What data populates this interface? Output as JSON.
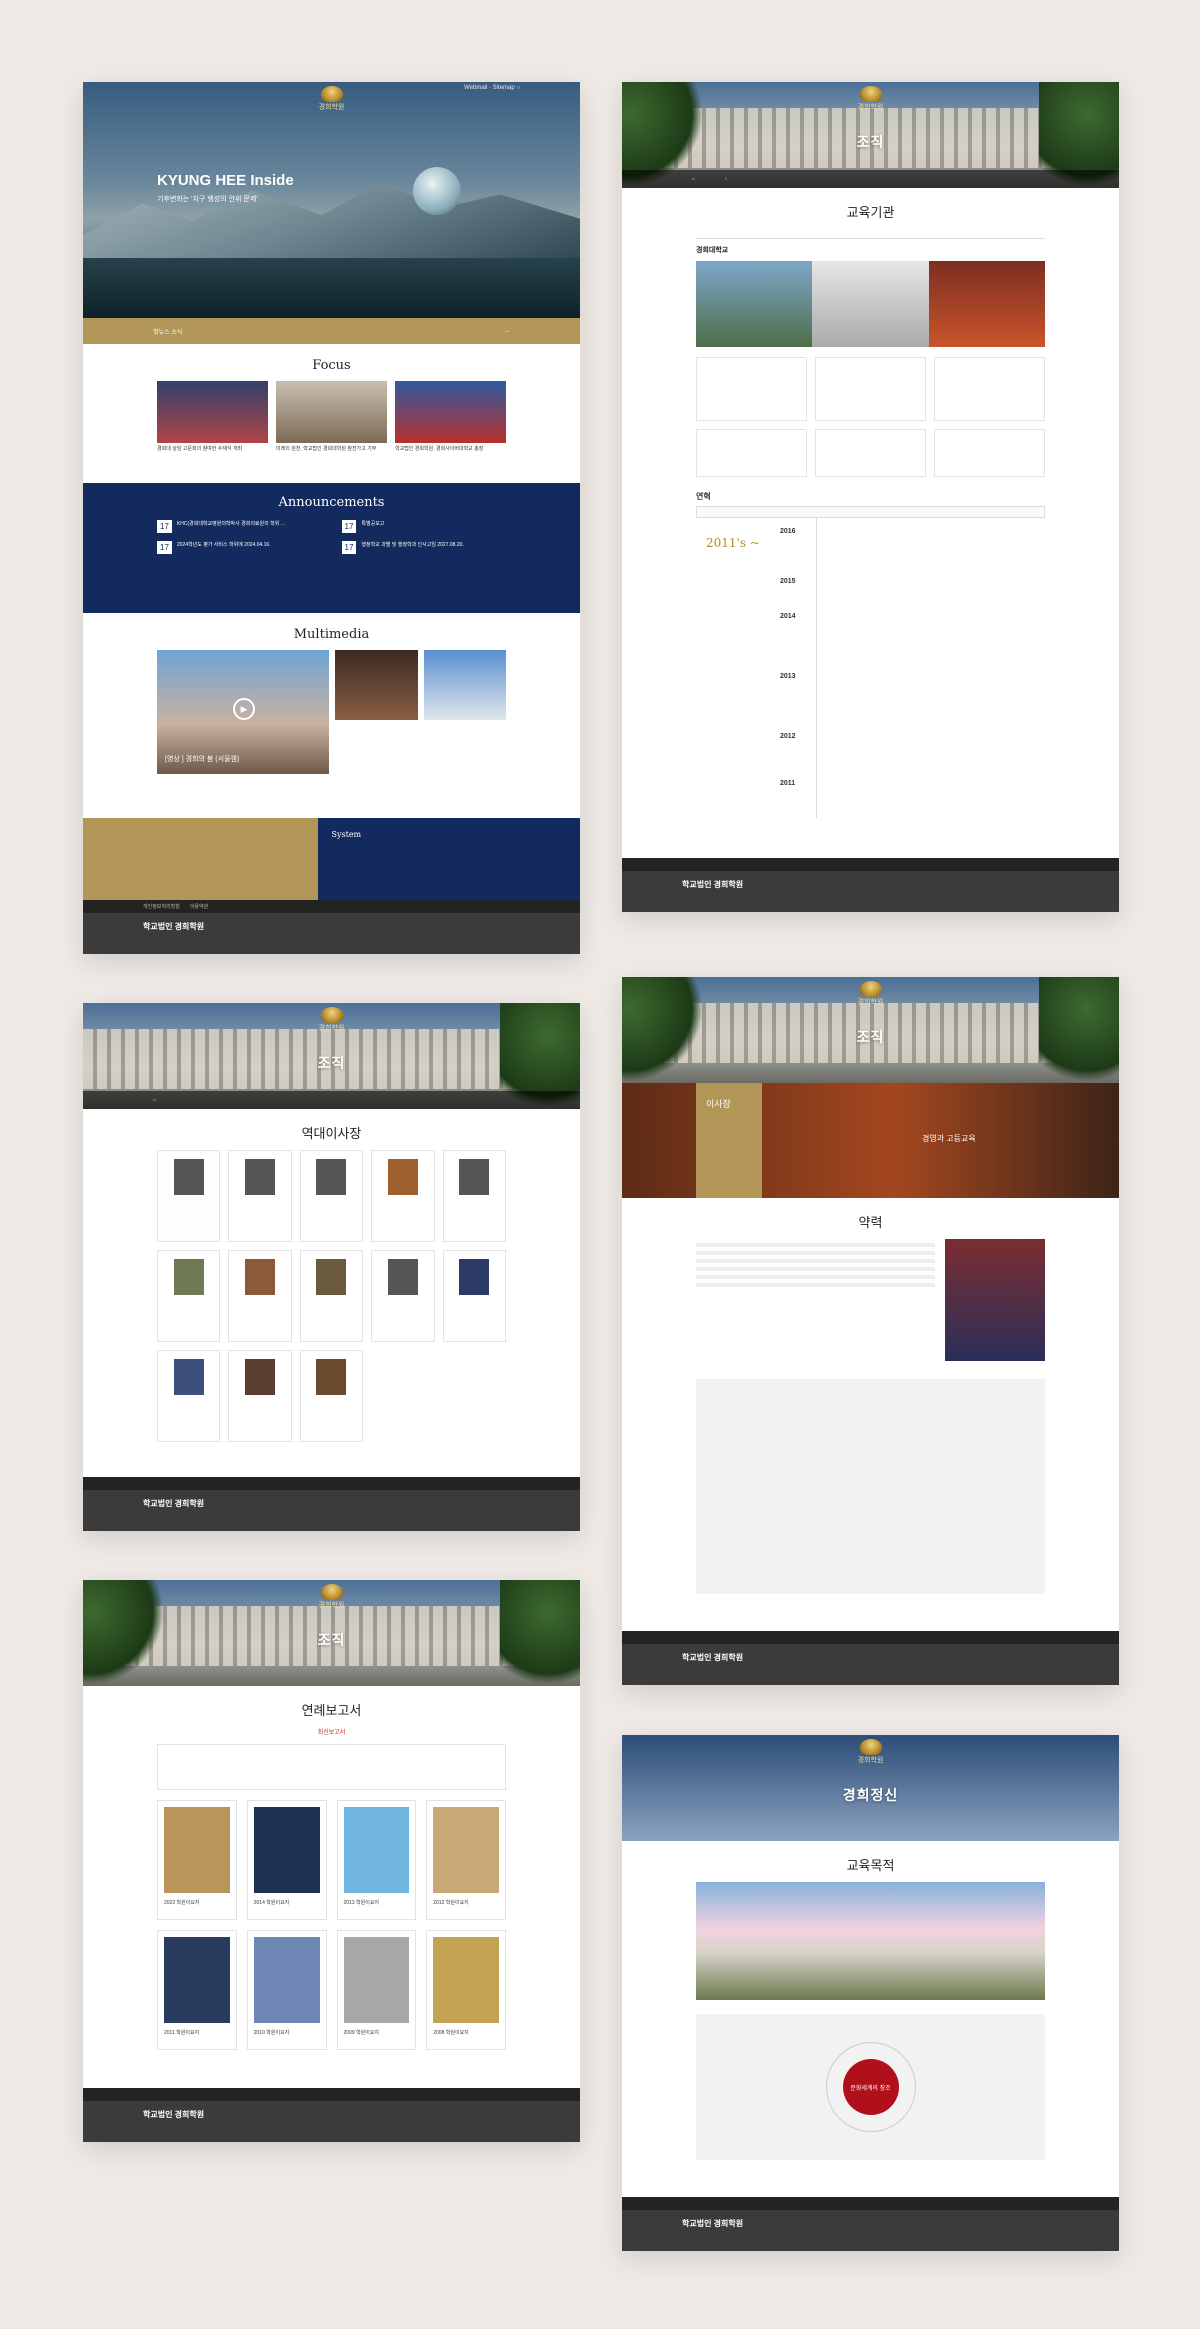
{
  "screen1": {
    "hero_title": "KYUNG HEE Inside",
    "hero_sub": "기후변화는 '지구 행성의 안위 문제'",
    "announcements_title": "Announcements",
    "focus_title": "Focus",
    "multimedia_title": "Multimedia",
    "mm_caption": "[영상 ] 경희의 봄 (서울캠)",
    "system_title": "System",
    "ann_items": [
      {
        "day": "17",
        "text": "KHC(경희대학교병원의학박사 경희의료원의 학위 ..."
      },
      {
        "day": "17",
        "text": "특별공모고"
      },
      {
        "day": "17",
        "text": "2024학년도 평가 서비스 학위에 2024.04.16."
      },
      {
        "day": "17",
        "text": "행정학교 과별 및 행정학과 인사고임 2027.08.20."
      }
    ],
    "focus_caps": [
      "경희대 상임 고문회의 참여한 수재식 개최",
      "미래의 원천, 학교법인 경희대학원 참전가고 기부",
      "학교법인 경희학원, 경희사이버대학교 총장"
    ]
  },
  "screen2": {
    "hero": "조직",
    "section": "교육기관",
    "sub": "경희대학교",
    "history": "연혁",
    "era": "2011's ~",
    "years": [
      "2016",
      "2015",
      "2014",
      "2013",
      "2012",
      "2011"
    ]
  },
  "screen3": {
    "hero": "조직",
    "section": "역대이사장"
  },
  "screen4": {
    "hero": "조직",
    "section": "약력",
    "role": "이사장",
    "banner": "경영과 고등교육"
  },
  "screen5": {
    "hero": "조직",
    "section": "연례보고서",
    "badge": "최신보고서",
    "reports": [
      "2022 학원이요지",
      "2014 학원이요지",
      "2013 학원이요지",
      "2012 학원이요지",
      "2011 학원이요지",
      "2010 학원이요지",
      "2009 학원이요지",
      "2008 학원이요지"
    ]
  },
  "screen6": {
    "hero": "경희정신",
    "section": "교육목적",
    "center": "문화세계의 창조"
  },
  "footer": {
    "brand": "학교법인 경희학원"
  }
}
